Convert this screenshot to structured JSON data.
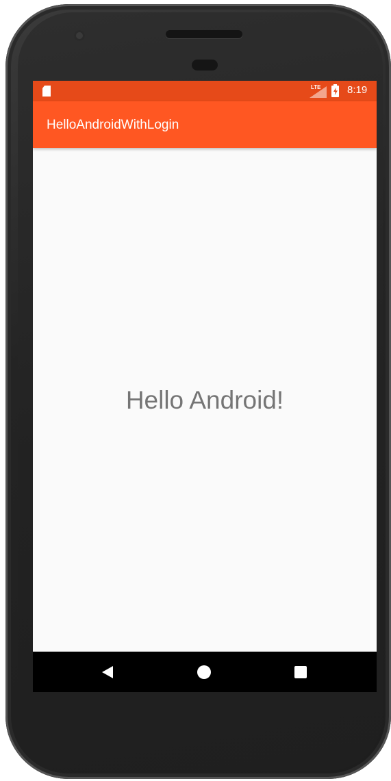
{
  "status_bar": {
    "time": "8:19",
    "network": "LTE",
    "icons": [
      "sd-card-icon",
      "signal-icon",
      "battery-charging-icon"
    ]
  },
  "app_bar": {
    "title": "HelloAndroidWithLogin"
  },
  "main": {
    "message": "Hello Android!"
  },
  "nav_bar": {
    "icons": [
      "back-icon",
      "home-icon",
      "recents-icon"
    ]
  },
  "colors": {
    "status_bar": "#e64a19",
    "app_bar": "#ff5722",
    "background": "#fafafa",
    "text": "#757575"
  }
}
